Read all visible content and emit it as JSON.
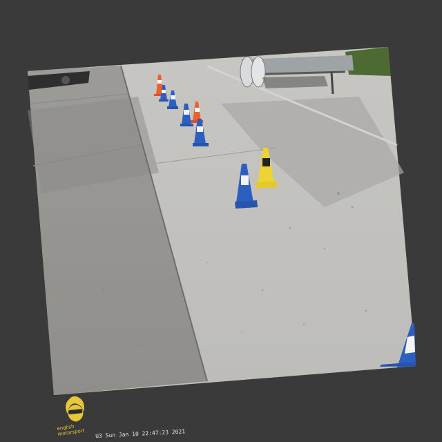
{
  "overlay": {
    "brand_line1": "english",
    "brand_line2": "motorsport",
    "timestamp": "U3 Sun Jan 10 22:47:23 2021"
  },
  "scene": {
    "content": [
      "concrete pavement",
      "traffic cones",
      "car trailer",
      "hedge"
    ],
    "cones": [
      "orange",
      "blue",
      "blue",
      "orange",
      "blue",
      "blue",
      "yellow",
      "blue",
      "blue"
    ]
  }
}
